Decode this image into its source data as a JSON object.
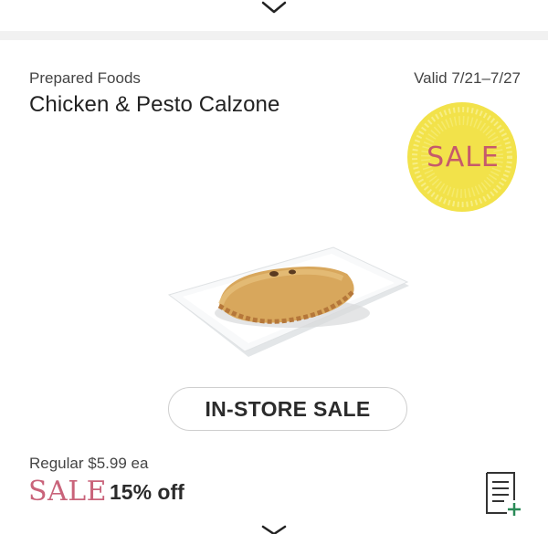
{
  "product": {
    "category": "Prepared Foods",
    "name": "Chicken & Pesto Calzone",
    "valid": "Valid 7/21–7/27",
    "badge_text": "SALE",
    "image_alt": "Chicken & Pesto Calzone"
  },
  "actions": {
    "instore_label": "IN-STORE SALE"
  },
  "pricing": {
    "regular": "Regular $5.99 ea",
    "sale_word": "SALE",
    "discount": "15% off"
  },
  "icons": {
    "top": "chevron-down-icon",
    "bottom": "chevron-down-icon",
    "list": "add-to-list-icon"
  },
  "colors": {
    "badge_yellow": "#f2e24a",
    "sale_pink": "#c9637a",
    "text_dark": "#222222",
    "text_secondary": "#444444"
  }
}
